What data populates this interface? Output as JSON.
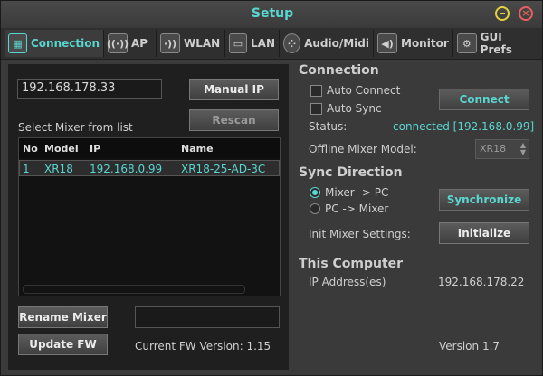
{
  "window": {
    "title": "Setup"
  },
  "tabs": [
    {
      "label": "Connection",
      "icon": "connection-icon"
    },
    {
      "label": "AP",
      "icon": "antenna-icon"
    },
    {
      "label": "WLAN",
      "icon": "wifi-icon"
    },
    {
      "label": "LAN",
      "icon": "ethernet-icon"
    },
    {
      "label": "Audio/Midi",
      "icon": "midi-icon"
    },
    {
      "label": "Monitor",
      "icon": "speaker-icon"
    },
    {
      "label": "GUI Prefs",
      "icon": "gear-icon"
    }
  ],
  "left": {
    "ip_value": "192.168.178.33",
    "manual_ip": "Manual IP",
    "rescan": "Rescan",
    "select_label": "Select Mixer from list",
    "columns": [
      "No",
      "Model",
      "IP",
      "Name"
    ],
    "rows": [
      {
        "no": "1",
        "model": "XR18",
        "ip": "192.168.0.99",
        "name": "XR18-25-AD-3C"
      }
    ],
    "rename_mixer": "Rename Mixer",
    "update_fw": "Update FW",
    "fw_version": "Current FW Version: 1.15"
  },
  "connection": {
    "heading": "Connection",
    "auto_connect": "Auto Connect",
    "auto_sync": "Auto Sync",
    "connect_button": "Connect",
    "status_label": "Status:",
    "status_value": "connected [192.168.0.99]",
    "offline_label": "Offline Mixer Model:",
    "offline_value": "XR18"
  },
  "sync": {
    "heading": "Sync Direction",
    "mixer_to_pc": "Mixer -> PC",
    "pc_to_mixer": "PC -> Mixer",
    "synchronize": "Synchronize",
    "init_label": "Init Mixer Settings:",
    "initialize": "Initialize"
  },
  "computer": {
    "heading": "This Computer",
    "ip_label": "IP Address(es)",
    "ip_value": "192.168.178.22",
    "version": "Version 1.7"
  },
  "colors": {
    "accent": "#5ad6d0",
    "minimize": "#e3d23a",
    "close": "#e86060"
  }
}
